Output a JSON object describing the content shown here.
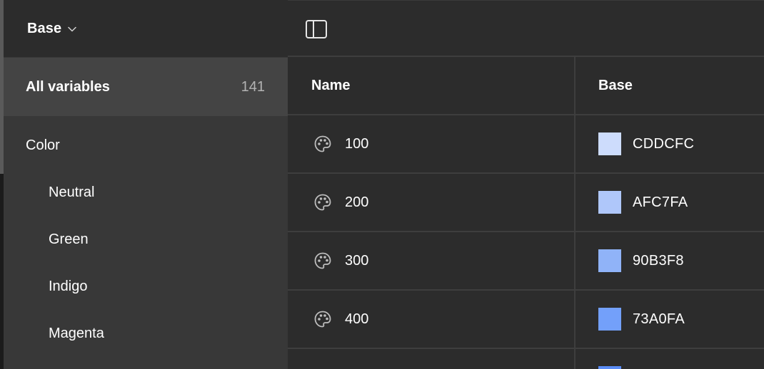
{
  "sidebar": {
    "collection_name": "Base",
    "all_variables": {
      "label": "All variables",
      "count": "141"
    },
    "groups": [
      {
        "label": "Color",
        "level": 0
      },
      {
        "label": "Neutral",
        "level": 1
      },
      {
        "label": "Green",
        "level": 1
      },
      {
        "label": "Indigo",
        "level": 1
      },
      {
        "label": "Magenta",
        "level": 1
      }
    ]
  },
  "toolbar": {
    "toggle_icon": "sidebar-toggle-icon"
  },
  "table": {
    "columns": [
      "Name",
      "Base"
    ],
    "rows": [
      {
        "icon": "palette-icon",
        "name": "100",
        "hex": "CDDCFC",
        "color": "#CDDCFC"
      },
      {
        "icon": "palette-icon",
        "name": "200",
        "hex": "AFC7FA",
        "color": "#AFC7FA"
      },
      {
        "icon": "palette-icon",
        "name": "300",
        "hex": "90B3F8",
        "color": "#90B3F8"
      },
      {
        "icon": "palette-icon",
        "name": "400",
        "hex": "73A0FA",
        "color": "#73A0FA"
      }
    ],
    "partial_next_row_color": "#5A8CF6"
  },
  "colors": {
    "sidebar_bg": "#383838",
    "selected_bg": "#444444",
    "main_bg": "#2c2c2c",
    "divider": "#3e3e3e",
    "text": "#ffffff",
    "muted_text": "#b3b3b3"
  }
}
